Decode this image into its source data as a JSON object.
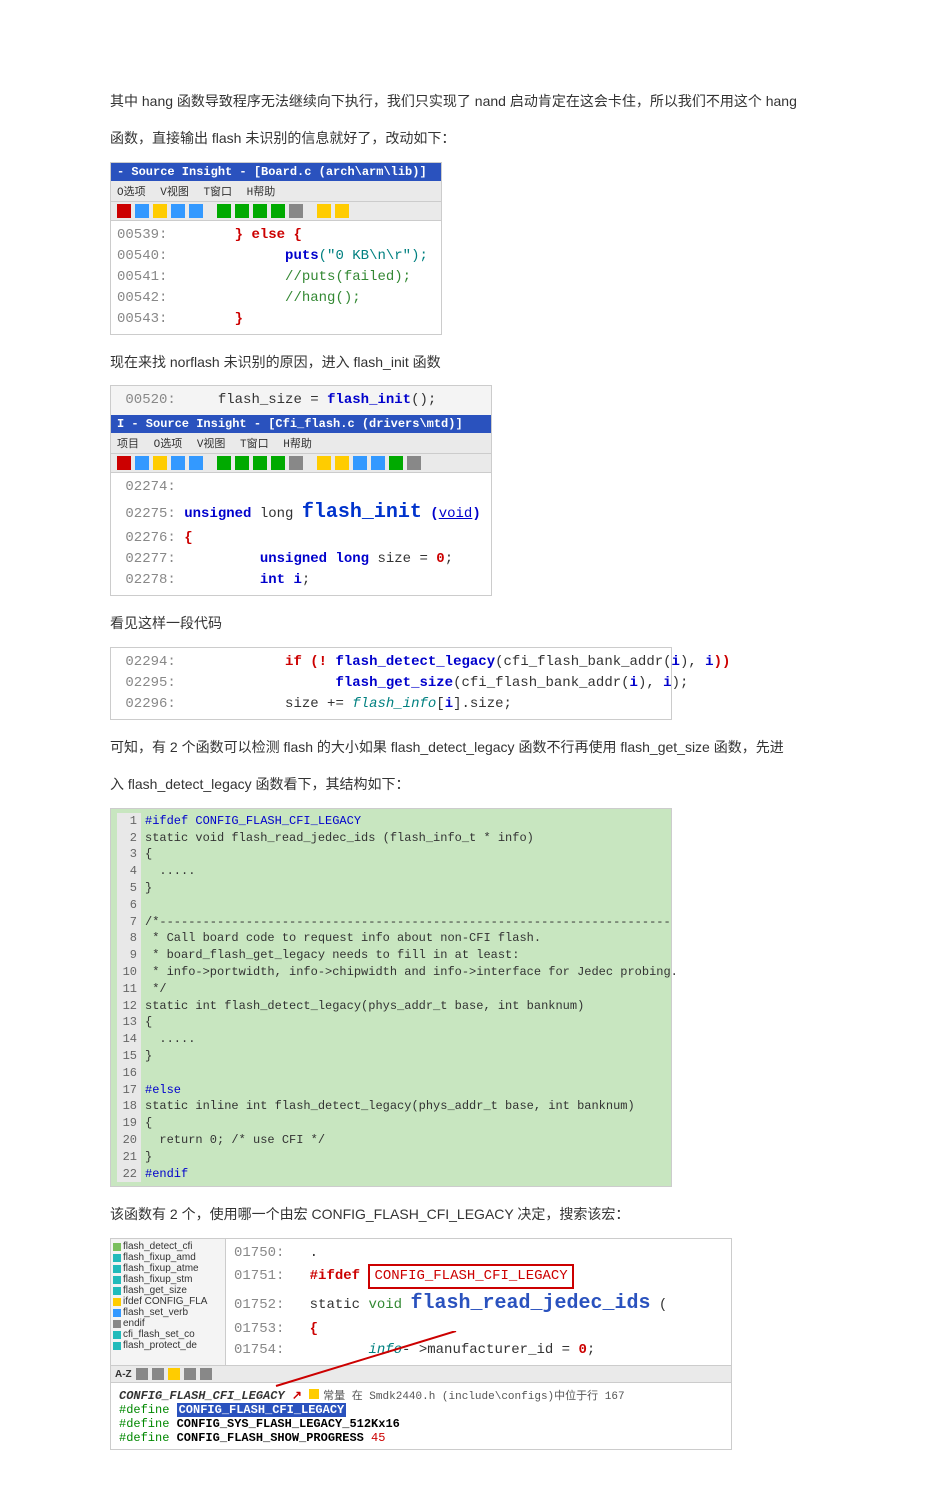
{
  "para1": "其中 hang 函数导致程序无法继续向下执行，我们只实现了 nand 启动肯定在这会卡住，所以我们不用这个 hang",
  "para2": "函数，直接输出 flash 未识别的信息就好了，改动如下：",
  "box1": {
    "title": "- Source Insight - [Board.c (arch\\arm\\lib)]",
    "menu": [
      "O选项",
      "V视图",
      "T窗口",
      "H帮助"
    ],
    "lines": {
      "l1_num": "00539:",
      "l1_a": "} ",
      "l1_b": "else",
      "l1_c": " {",
      "l2_num": "00540:",
      "l2_a": "puts",
      "l2_b": "(\"0 KB\\n\\r\");",
      "l3_num": "00541:",
      "l3_a": "//puts(failed);",
      "l4_num": "00542:",
      "l4_a": "//hang();",
      "l5_num": "00543:",
      "l5_a": "}"
    }
  },
  "para3": "现在来找 norflash 未识别的原因，进入 flash_init 函数",
  "box2": {
    "pre_num": "00520:",
    "pre_txt_a": "flash_size = ",
    "pre_txt_b": "flash_init",
    "pre_txt_c": "();",
    "title": "I - Source Insight - [Cfi_flash.c (drivers\\mtd)]",
    "menu": [
      "项目",
      "O选项",
      "V视图",
      "T窗口",
      "H帮助"
    ],
    "lines": {
      "l1_num": "02274:",
      "l2_num": "02275:",
      "l2_a": "unsigned",
      "l2_b": " long ",
      "l2_c": "flash_init",
      "l2_d": " (",
      "l2_e": "void",
      "l2_f": ")",
      "l3_num": "02276:",
      "l3_a": "{",
      "l4_num": "02277:",
      "l4_a": "unsigned long",
      "l4_b": " size = ",
      "l4_c": "0",
      "l4_d": ";",
      "l5_num": "02278:",
      "l5_a": "int",
      "l5_b": " i",
      "l5_c": ";"
    }
  },
  "para4": "看见这样一段代码",
  "box3": {
    "l1_num": "02294:",
    "l1_a": "if",
    "l1_b": " (! ",
    "l1_c": "flash_detect_legacy",
    "l1_d": "(cfi_flash_bank_addr(",
    "l1_e": "i",
    "l1_f": "), ",
    "l1_g": "i",
    "l1_h": "))",
    "l2_num": "02295:",
    "l2_a": "flash_get_size",
    "l2_b": "(cfi_flash_bank_addr(",
    "l2_c": "i",
    "l2_d": "), ",
    "l2_e": "i",
    "l2_f": ");",
    "l3_num": "02296:",
    "l3_a": "size += ",
    "l3_b": "flash_info",
    "l3_c": "[",
    "l3_d": "i",
    "l3_e": "].size;"
  },
  "para5": "可知，有 2 个函数可以检测 flash 的大小如果 flash_detect_legacy 函数不行再使用 flash_get_size 函数，先进",
  "para6": "入 flash_detect_legacy 函数看下，其结构如下：",
  "box4": {
    "lines": [
      "#ifdef CONFIG_FLASH_CFI_LEGACY",
      "static void flash_read_jedec_ids (flash_info_t * info)",
      "{",
      "  .....",
      "}",
      "",
      "/*-----------------------------------------------------------------------",
      " * Call board code to request info about non-CFI flash.",
      " * board_flash_get_legacy needs to fill in at least:",
      " * info->portwidth, info->chipwidth and info->interface for Jedec probing.",
      " */",
      "static int flash_detect_legacy(phys_addr_t base, int banknum)",
      "{",
      "  .....",
      "}",
      "",
      "#else",
      "static inline int flash_detect_legacy(phys_addr_t base, int banknum)",
      "{",
      "  return 0; /* use CFI */",
      "}",
      "#endif"
    ]
  },
  "para7": "该函数有 2 个，使用哪一个由宏 CONFIG_FLASH_CFI_LEGACY  决定，搜索该宏：",
  "box5": {
    "tree": [
      "flash_detect_cfi",
      "flash_fixup_amd",
      "flash_fixup_atme",
      "flash_fixup_stm",
      "flash_get_size",
      "ifdef CONFIG_FLA",
      "flash_set_verb",
      "endif",
      "cfi_flash_set_co",
      "flash_protect_de"
    ],
    "lines": {
      "l1_num": "01750:",
      "l1_a": ".",
      "l2_num": "01751:",
      "l2_a": "#ifdef",
      "l2_b": "CONFIG_FLASH_CFI_LEGACY",
      "l3_num": "01752:",
      "l3_a": "static ",
      "l3_b": "void",
      "l3_c": "flash_read_jedec_ids",
      "l3_d": " (",
      "l4_num": "01753:",
      "l4_a": "{",
      "l5_num": "01754:",
      "l5_a": "info",
      "l5_b": "- >manufacturer_id = ",
      "l5_c": "0",
      "l5_d": ";"
    },
    "toolbar_tabs": [
      "A-Z"
    ],
    "result_title": "CONFIG_FLASH_CFI_LEGACY",
    "result_note_a": "常量 在 Smdk2440.h (include\\configs)中位于行 167",
    "r1_a": "#define ",
    "r1_b": "CONFIG_FLASH_CFI_LEGACY",
    "r2_a": "#define ",
    "r2_b": "CONFIG_SYS_FLASH_LEGACY_512Kx16",
    "r3_a": "#define ",
    "r3_b": "CONFIG_FLASH_SHOW_PROGRESS",
    "r3_c": "  45"
  }
}
